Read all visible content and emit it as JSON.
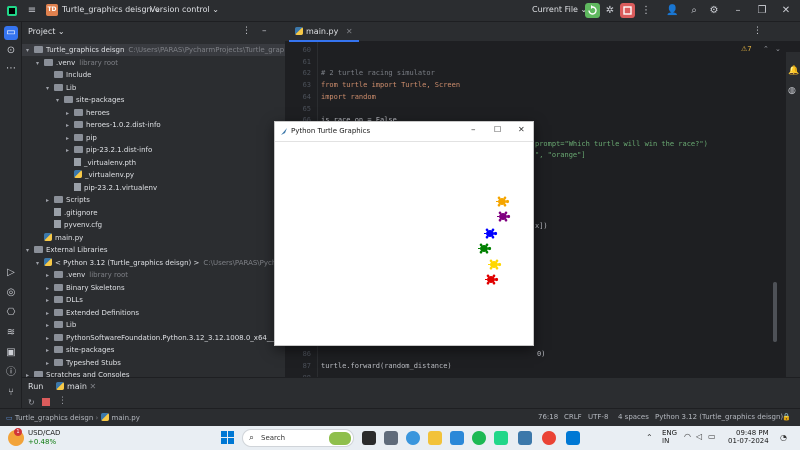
{
  "titlebar": {
    "project_badge": "TD",
    "project_name": "Turtle_graphics deisgn",
    "version_control": "Version control",
    "current_file": "Current File"
  },
  "project_panel": {
    "title": "Project",
    "items": [
      {
        "label": "Turtle_graphics deisgn",
        "extra": "C:\\Users\\PARAS\\PycharmProjects\\Turtle_grap",
        "indent": 0,
        "kind": "folder",
        "open": true
      },
      {
        "label": ".venv",
        "extra": "library root",
        "indent": 1,
        "kind": "folder",
        "open": true
      },
      {
        "label": "Include",
        "extra": "",
        "indent": 2,
        "kind": "folder",
        "open": null
      },
      {
        "label": "Lib",
        "extra": "",
        "indent": 2,
        "kind": "folder",
        "open": true
      },
      {
        "label": "site-packages",
        "extra": "",
        "indent": 3,
        "kind": "folder",
        "open": true
      },
      {
        "label": "heroes",
        "extra": "",
        "indent": 4,
        "kind": "folder",
        "open": false
      },
      {
        "label": "heroes-1.0.2.dist-info",
        "extra": "",
        "indent": 4,
        "kind": "folder",
        "open": false
      },
      {
        "label": "pip",
        "extra": "",
        "indent": 4,
        "kind": "folder",
        "open": false
      },
      {
        "label": "pip-23.2.1.dist-info",
        "extra": "",
        "indent": 4,
        "kind": "folder",
        "open": false
      },
      {
        "label": "_virtualenv.pth",
        "extra": "",
        "indent": 4,
        "kind": "file",
        "open": null
      },
      {
        "label": "_virtualenv.py",
        "extra": "",
        "indent": 4,
        "kind": "py",
        "open": null
      },
      {
        "label": "pip-23.2.1.virtualenv",
        "extra": "",
        "indent": 4,
        "kind": "file",
        "open": null
      },
      {
        "label": "Scripts",
        "extra": "",
        "indent": 2,
        "kind": "folder",
        "open": false
      },
      {
        "label": ".gitignore",
        "extra": "",
        "indent": 2,
        "kind": "file",
        "open": null
      },
      {
        "label": "pyvenv.cfg",
        "extra": "",
        "indent": 2,
        "kind": "file",
        "open": null
      },
      {
        "label": "main.py",
        "extra": "",
        "indent": 1,
        "kind": "py",
        "open": null
      },
      {
        "label": "External Libraries",
        "extra": "",
        "indent": 0,
        "kind": "folder",
        "open": true
      },
      {
        "label": "< Python 3.12 (Turtle_graphics deisgn) >",
        "extra": "C:\\Users\\PARAS\\Pycharm",
        "indent": 1,
        "kind": "py",
        "open": true
      },
      {
        "label": ".venv",
        "extra": "library root",
        "indent": 2,
        "kind": "folder",
        "open": false
      },
      {
        "label": "Binary Skeletons",
        "extra": "",
        "indent": 2,
        "kind": "folder",
        "open": false
      },
      {
        "label": "DLLs",
        "extra": "",
        "indent": 2,
        "kind": "folder",
        "open": false
      },
      {
        "label": "Extended Definitions",
        "extra": "",
        "indent": 2,
        "kind": "folder",
        "open": false
      },
      {
        "label": "Lib",
        "extra": "",
        "indent": 2,
        "kind": "folder",
        "open": false
      },
      {
        "label": "PythonSoftwareFoundation.Python.3.12_3.12.1008.0_x64__qbz5",
        "extra": "",
        "indent": 2,
        "kind": "folder",
        "open": false
      },
      {
        "label": "site-packages",
        "extra": "",
        "indent": 2,
        "kind": "folder",
        "open": false
      },
      {
        "label": "Typeshed Stubs",
        "extra": "",
        "indent": 2,
        "kind": "folder",
        "open": false
      },
      {
        "label": "Scratches and Consoles",
        "extra": "",
        "indent": 0,
        "kind": "folder",
        "open": false
      }
    ]
  },
  "editor": {
    "tab_label": "main.py",
    "warning_count": "7",
    "lines": [
      {
        "n": "60",
        "text": ""
      },
      {
        "n": "61",
        "text": ""
      },
      {
        "n": "62",
        "text": "# 2 turtle racing simulator"
      },
      {
        "n": "63",
        "text": "from turtle import Turtle, Screen"
      },
      {
        "n": "64",
        "text": "import random"
      },
      {
        "n": "65",
        "text": ""
      },
      {
        "n": "66",
        "text": "is_race_on = False"
      },
      {
        "n": "67",
        "text": ""
      },
      {
        "n": "68",
        "text": "prompt=\"Which turtle will win the race?\")"
      },
      {
        "n": "69",
        "text": "\", \"orange\"]"
      },
      {
        "n": "70",
        "text": ""
      },
      {
        "n": "71",
        "text": ""
      },
      {
        "n": "72",
        "text": ""
      },
      {
        "n": "73",
        "text": ""
      },
      {
        "n": "74",
        "text": ""
      },
      {
        "n": "75",
        "text": "x])"
      },
      {
        "n": "76",
        "text": ""
      },
      {
        "n": "77",
        "text": ""
      },
      {
        "n": "78",
        "text": ""
      },
      {
        "n": "79",
        "text": ""
      },
      {
        "n": "80",
        "text": ""
      },
      {
        "n": "81",
        "text": ""
      },
      {
        "n": "82",
        "text": ""
      },
      {
        "n": "83",
        "text": ""
      },
      {
        "n": "84",
        "text": ""
      },
      {
        "n": "85",
        "text": ""
      },
      {
        "n": "86",
        "text": "0)"
      },
      {
        "n": "87",
        "text": "        turtle.forward(random_distance)"
      },
      {
        "n": "88",
        "text": ""
      },
      {
        "n": "89",
        "text": ""
      }
    ]
  },
  "run_panel": {
    "run_label": "Run",
    "config": "main"
  },
  "statusbar": {
    "breadcrumb_project": "Turtle_graphics deisgn",
    "breadcrumb_file": "main.py",
    "position": "76:18",
    "line_sep": "CRLF",
    "encoding": "UTF-8",
    "indent": "4 spaces",
    "interpreter": "Python 3.12 (Turtle_graphics deisgn)"
  },
  "turtle_window": {
    "title": "Python Turtle Graphics",
    "turtles": [
      {
        "color": "#f5a500"
      },
      {
        "color": "#800080"
      },
      {
        "color": "#0000ff"
      },
      {
        "color": "#008000"
      },
      {
        "color": "#ffd700"
      },
      {
        "color": "#e00000"
      }
    ]
  },
  "taskbar": {
    "ticker": "USD/CAD",
    "ticker_change": "+0.48%",
    "search_placeholder": "Search",
    "lang_1": "ENG",
    "lang_2": "IN",
    "time": "09:48 PM",
    "date": "01-07-2024"
  },
  "colors": {
    "accent_green": "#5fb85f",
    "accent_red": "#db5c5c",
    "comment": "#7a7e85",
    "keyword": "#cf8e6d",
    "string": "#6aab73"
  }
}
